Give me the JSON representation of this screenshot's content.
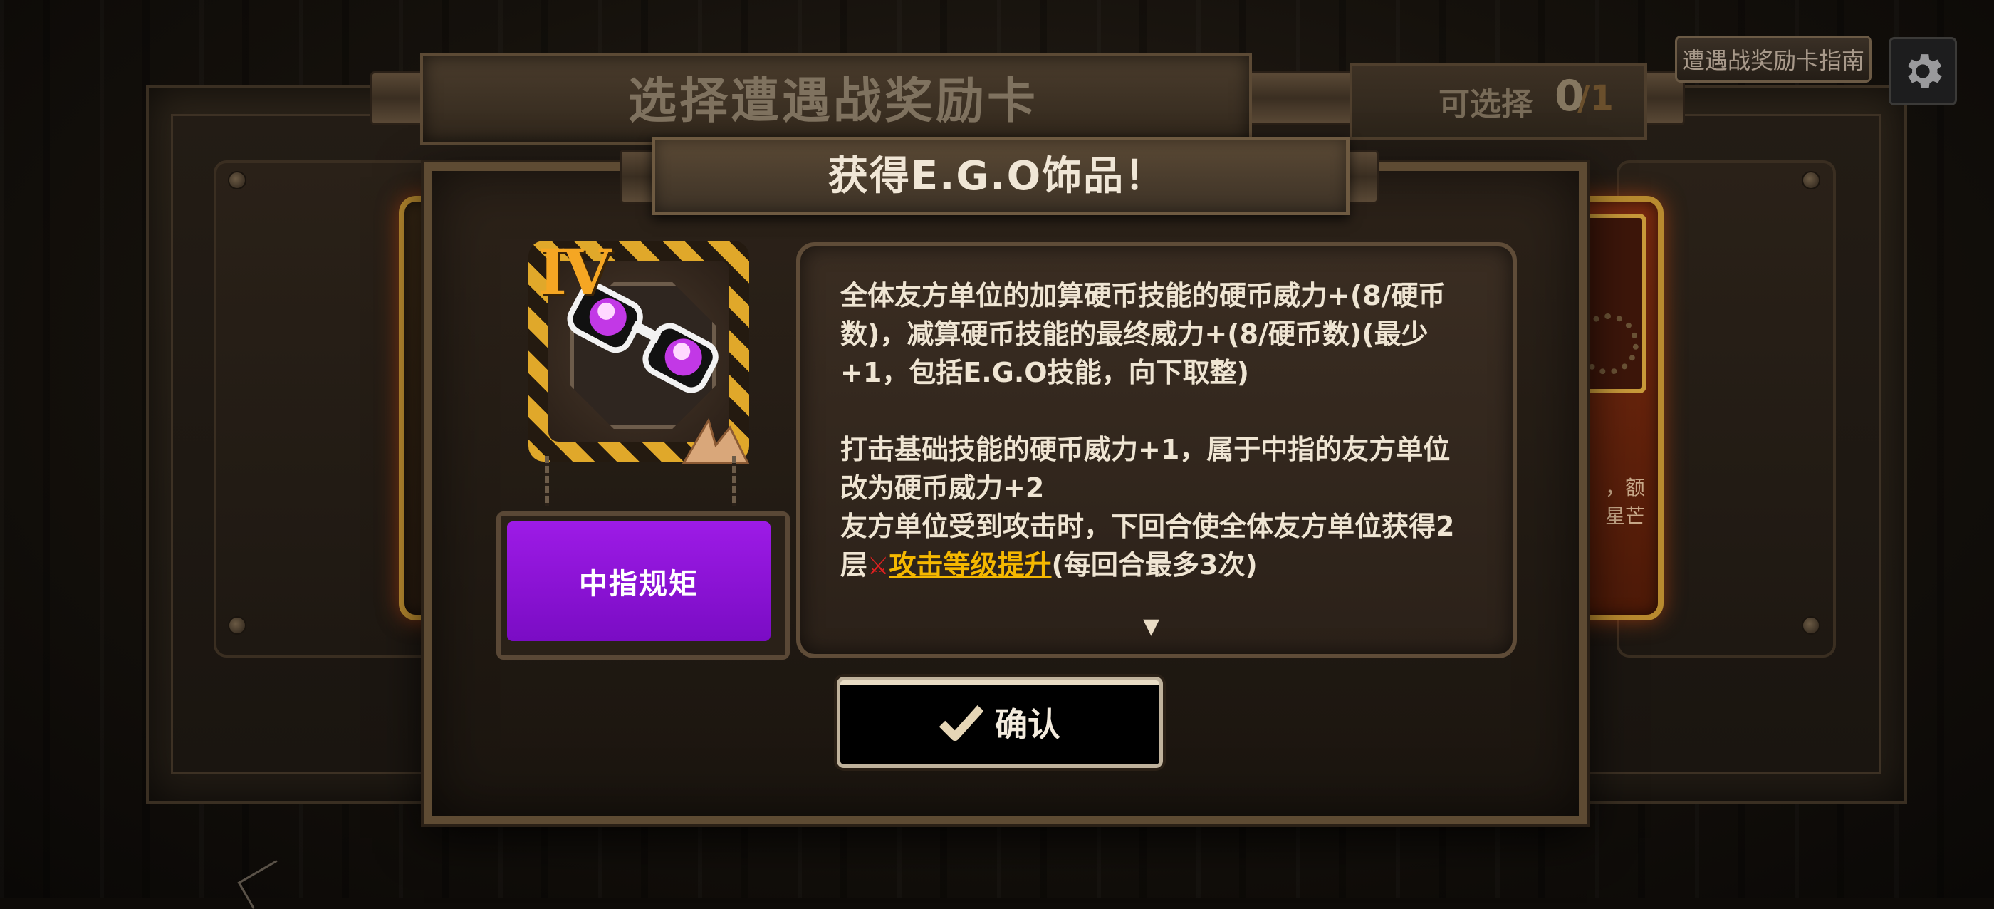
{
  "header": {
    "title": "选择遭遇战奖励卡",
    "selectable_label": "可选择",
    "selected_count": "0",
    "total_count": "/1"
  },
  "guide_button": "遭遇战奖励卡指南",
  "settings_icon": "gear-icon",
  "modal": {
    "title": "获得E.G.O饰品！",
    "ego": {
      "tier": "IV",
      "name": "中指规矩",
      "name_color": "#9d1be6",
      "icon": "sunglasses-icon"
    },
    "description": {
      "para1": "全体友方单位的加算硬币技能的硬币威力+(8/硬币数)，减算硬币技能的最终威力+(8/硬币数)(最少+1，包括E.G.O技能，向下取整)",
      "para2": "打击基础技能的硬币威力+1，属于中指的友方单位改为硬币威力+2",
      "para3_prefix": "友方单位受到攻击时，下回合使全体友方单位获得2层",
      "keyword": "攻击等级提升",
      "keyword_color": "#f5b800",
      "para3_suffix": "(每回合最多3次)"
    },
    "scroll_indicator": "▼",
    "confirm_label": "确认"
  },
  "background_card_right_text": "，额\n星芒"
}
